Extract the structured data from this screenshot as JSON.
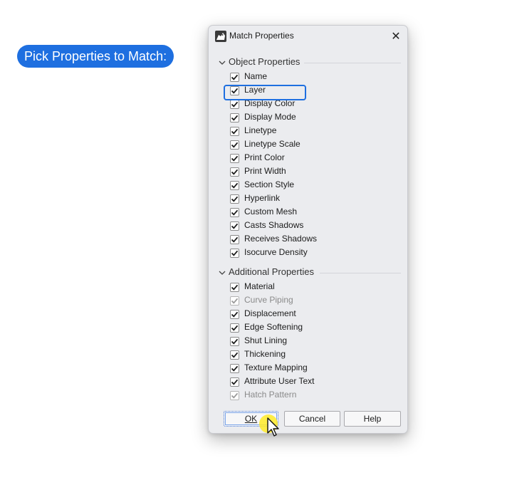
{
  "callout": {
    "text": "Pick Properties to Match:"
  },
  "dialog": {
    "title": "Match Properties",
    "close_glyph": "✕",
    "groups": [
      {
        "label": "Object Properties",
        "items": [
          {
            "label": "Name",
            "checked": true,
            "enabled": true
          },
          {
            "label": "Layer",
            "checked": true,
            "enabled": true,
            "highlighted": true
          },
          {
            "label": "Display Color",
            "checked": true,
            "enabled": true
          },
          {
            "label": "Display Mode",
            "checked": true,
            "enabled": true
          },
          {
            "label": "Linetype",
            "checked": true,
            "enabled": true
          },
          {
            "label": "Linetype Scale",
            "checked": true,
            "enabled": true
          },
          {
            "label": "Print Color",
            "checked": true,
            "enabled": true
          },
          {
            "label": "Print Width",
            "checked": true,
            "enabled": true
          },
          {
            "label": "Section Style",
            "checked": true,
            "enabled": true
          },
          {
            "label": "Hyperlink",
            "checked": true,
            "enabled": true
          },
          {
            "label": "Custom Mesh",
            "checked": true,
            "enabled": true
          },
          {
            "label": "Casts Shadows",
            "checked": true,
            "enabled": true
          },
          {
            "label": "Receives Shadows",
            "checked": true,
            "enabled": true
          },
          {
            "label": "Isocurve Density",
            "checked": true,
            "enabled": true
          }
        ]
      },
      {
        "label": "Additional Properties",
        "items": [
          {
            "label": "Material",
            "checked": true,
            "enabled": true
          },
          {
            "label": "Curve Piping",
            "checked": true,
            "enabled": false
          },
          {
            "label": "Displacement",
            "checked": true,
            "enabled": true
          },
          {
            "label": "Edge Softening",
            "checked": true,
            "enabled": true
          },
          {
            "label": "Shut Lining",
            "checked": true,
            "enabled": true
          },
          {
            "label": "Thickening",
            "checked": true,
            "enabled": true
          },
          {
            "label": "Texture Mapping",
            "checked": true,
            "enabled": true
          },
          {
            "label": "Attribute User Text",
            "checked": true,
            "enabled": true
          },
          {
            "label": "Hatch Pattern",
            "checked": true,
            "enabled": false
          }
        ]
      }
    ],
    "buttons": {
      "ok": "OK",
      "cancel": "Cancel",
      "help": "Help"
    }
  },
  "colors": {
    "accent": "#1e6fe0",
    "dialog_bg": "#ebecef",
    "disabled_text": "#8a8a8a"
  },
  "icons": {
    "app": "rhino-app-icon",
    "close": "close-icon",
    "chevron": "chevron-down-icon",
    "check": "checkmark-icon",
    "cursor": "mouse-pointer-icon"
  }
}
